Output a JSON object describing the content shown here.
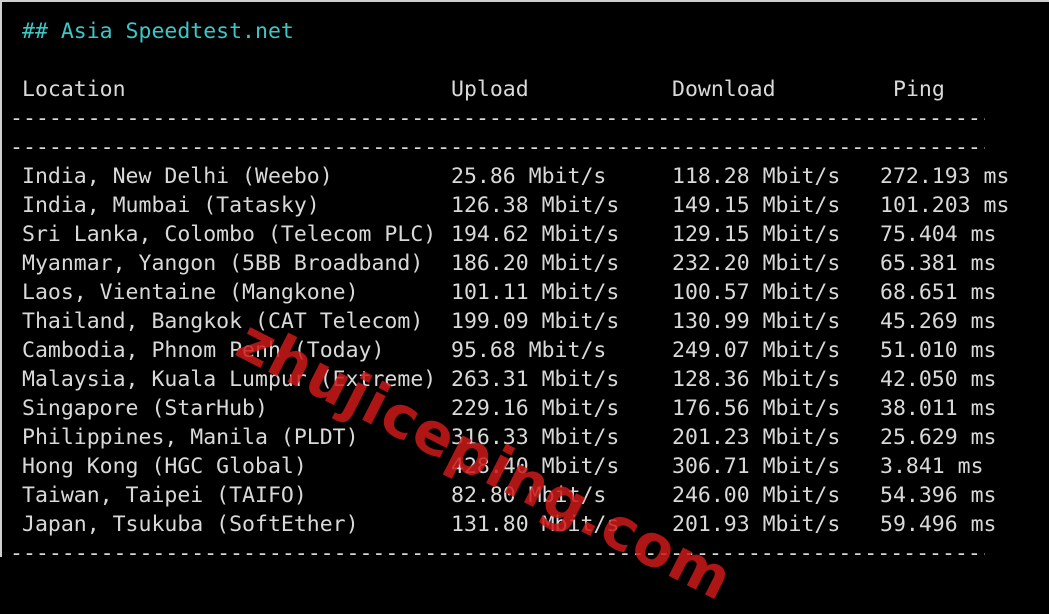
{
  "terminal": {
    "heading": "## Asia Speedtest.net",
    "headers": {
      "location": "Location",
      "upload": "Upload",
      "download": "Download",
      "ping": "Ping"
    },
    "divider": "----------------------------------------------------------------------------------------------------------------",
    "rows": [
      {
        "location": "India, New Delhi (Weebo)",
        "upload": "25.86 Mbit/s",
        "download": "118.28 Mbit/s",
        "ping": "272.193 ms"
      },
      {
        "location": "India, Mumbai (Tatasky)",
        "upload": "126.38 Mbit/s",
        "download": "149.15 Mbit/s",
        "ping": "101.203 ms"
      },
      {
        "location": "Sri Lanka, Colombo (Telecom PLC)",
        "upload": "194.62 Mbit/s",
        "download": "129.15 Mbit/s",
        "ping": "75.404 ms"
      },
      {
        "location": "Myanmar, Yangon (5BB Broadband)",
        "upload": "186.20 Mbit/s",
        "download": "232.20 Mbit/s",
        "ping": "65.381 ms"
      },
      {
        "location": "Laos, Vientaine (Mangkone)",
        "upload": "101.11 Mbit/s",
        "download": "100.57 Mbit/s",
        "ping": "68.651 ms"
      },
      {
        "location": "Thailand, Bangkok (CAT Telecom)",
        "upload": "199.09 Mbit/s",
        "download": "130.99 Mbit/s",
        "ping": "45.269 ms"
      },
      {
        "location": "Cambodia, Phnom Penh (Today)",
        "upload": "95.68 Mbit/s",
        "download": "249.07 Mbit/s",
        "ping": "51.010 ms"
      },
      {
        "location": "Malaysia, Kuala Lumpur (Extreme)",
        "upload": "263.31 Mbit/s",
        "download": "128.36 Mbit/s",
        "ping": "42.050 ms"
      },
      {
        "location": "Singapore (StarHub)",
        "upload": "229.16 Mbit/s",
        "download": "176.56 Mbit/s",
        "ping": "38.011 ms"
      },
      {
        "location": "Philippines, Manila (PLDT)",
        "upload": "316.33 Mbit/s",
        "download": "201.23 Mbit/s",
        "ping": "25.629 ms"
      },
      {
        "location": "Hong Kong (HGC Global)",
        "upload": "428.40 Mbit/s",
        "download": "306.71 Mbit/s",
        "ping": "3.841 ms"
      },
      {
        "location": "Taiwan, Taipei (TAIFO)",
        "upload": "82.80 Mbit/s",
        "download": "246.00 Mbit/s",
        "ping": "54.396 ms"
      },
      {
        "location": "Japan, Tsukuba (SoftEther)",
        "upload": "131.80 Mbit/s",
        "download": "201.93 Mbit/s",
        "ping": "59.496 ms"
      }
    ]
  },
  "watermark": {
    "text": "zhujiceping.com"
  },
  "colors": {
    "background": "#000000",
    "text": "#d9d9d9",
    "heading": "#3cc7c7",
    "watermark": "#cd1919"
  }
}
